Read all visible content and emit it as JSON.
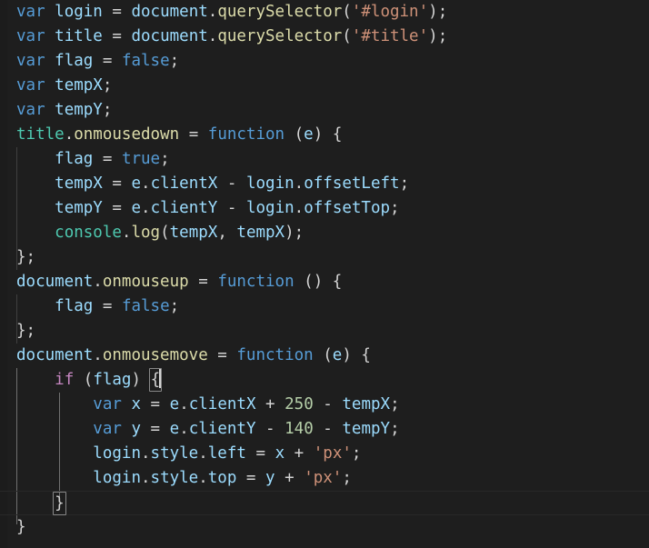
{
  "editor": {
    "language": "javascript",
    "theme": "dark-plus",
    "background_color": "#1e1e1e",
    "foreground_color": "#d4d4d4",
    "font_size_px": 17.5,
    "line_height_px": 27,
    "total_lines": 21,
    "colors": {
      "keyword": "#569cd6",
      "control": "#c586c0",
      "variable": "#9cdcfe",
      "function": "#dcdcaa",
      "class": "#4ec9b0",
      "string": "#ce9178",
      "number": "#b5cea8",
      "punctuation": "#d4d4d4",
      "indent_guide": "#404040",
      "indent_guide_active": "#707070",
      "bracket_match_border": "#888888",
      "current_line_border": "#282828"
    }
  },
  "lines": [
    {
      "n": 1,
      "text": "var login = document.querySelector('#login');"
    },
    {
      "n": 2,
      "text": "var title = document.querySelector('#title');"
    },
    {
      "n": 3,
      "text": "var flag = false;"
    },
    {
      "n": 4,
      "text": "var tempX;"
    },
    {
      "n": 5,
      "text": "var tempY;"
    },
    {
      "n": 6,
      "text": "title.onmousedown = function (e) {"
    },
    {
      "n": 7,
      "text": "    flag = true;"
    },
    {
      "n": 8,
      "text": "    tempX = e.clientX - login.offsetLeft;"
    },
    {
      "n": 9,
      "text": "    tempY = e.clientY - login.offsetTop;"
    },
    {
      "n": 10,
      "text": "    console.log(tempX, tempX);"
    },
    {
      "n": 11,
      "text": "};"
    },
    {
      "n": 12,
      "text": "document.onmouseup = function () {"
    },
    {
      "n": 13,
      "text": "    flag = false;"
    },
    {
      "n": 14,
      "text": "};"
    },
    {
      "n": 15,
      "text": "document.onmousemove = function (e) {"
    },
    {
      "n": 16,
      "text": "    if (flag) {"
    },
    {
      "n": 17,
      "text": "        var x = e.clientX + 250 - tempX;"
    },
    {
      "n": 18,
      "text": "        var y = e.clientY - 140 - tempY;"
    },
    {
      "n": 19,
      "text": "        login.style.left = x + 'px';"
    },
    {
      "n": 20,
      "text": "        login.style.top = y + 'px';"
    },
    {
      "n": 21,
      "text": "    }"
    },
    {
      "n": 22,
      "text": "}"
    }
  ],
  "tokens": {
    "kw_var": "var",
    "kw_function": "function",
    "kw_true": "true",
    "kw_false": "false",
    "ctrl_if": "if",
    "id_login": "login",
    "id_title": "title",
    "id_flag": "flag",
    "id_tempX": "tempX",
    "id_tempY": "tempY",
    "id_document": "document",
    "id_console": "console",
    "id_e": "e",
    "id_x": "x",
    "id_y": "y",
    "fn_querySelector": "querySelector",
    "fn_log": "log",
    "prop_onmousedown": "onmousedown",
    "prop_onmouseup": "onmouseup",
    "prop_onmousemove": "onmousemove",
    "prop_clientX": "clientX",
    "prop_clientY": "clientY",
    "prop_offsetLeft": "offsetLeft",
    "prop_offsetTop": "offsetTop",
    "prop_style": "style",
    "prop_left": "left",
    "prop_top": "top",
    "str_login": "'#login'",
    "str_title": "'#title'",
    "str_px": "'px'",
    "num_250": "250",
    "num_140": "140",
    "op_assign": "=",
    "op_plus": "+",
    "op_minus": "-",
    "semi": ";",
    "comma": ",",
    "dot": ".",
    "paren_open": "(",
    "paren_close": ")",
    "brace_open": "{",
    "brace_close": "}",
    "brace_close_semi": "};",
    "space": " "
  }
}
